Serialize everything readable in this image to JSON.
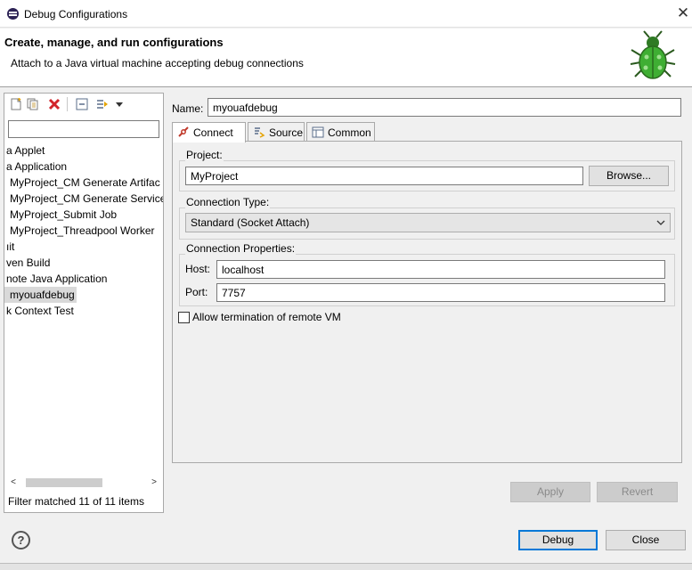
{
  "window": {
    "title": "Debug Configurations"
  },
  "header": {
    "title": "Create, manage, and run configurations",
    "description": "Attach to a Java virtual machine accepting debug connections"
  },
  "left": {
    "toolbar": [
      "new-launch-config-icon",
      "duplicate-icon",
      "delete-icon",
      "collapse-all-icon",
      "filter-icon",
      "view-menu-icon"
    ],
    "filter_value": "",
    "tree": [
      "a Applet",
      "a Application",
      "MyProject_CM Generate Artifac",
      "MyProject_CM Generate Service",
      "MyProject_Submit Job",
      "MyProject_Threadpool Worker",
      "ıit",
      "ven Build",
      "note Java Application",
      "myouafdebug",
      "k Context Test"
    ],
    "selected_index": 9,
    "filter_status": "Filter matched 11 of 11 items"
  },
  "config": {
    "name_label": "Name:",
    "name_value": "myouafdebug",
    "tabs": [
      {
        "label": "Connect",
        "icon": "connect-icon",
        "active": true
      },
      {
        "label": "Source",
        "icon": "source-icon",
        "active": false
      },
      {
        "label": "Common",
        "icon": "common-icon",
        "active": false
      }
    ],
    "project_label": "Project:",
    "project_value": "MyProject",
    "browse_label": "Browse...",
    "connection_type_label": "Connection Type:",
    "connection_type_value": "Standard (Socket Attach)",
    "connection_props_label": "Connection Properties:",
    "host_label": "Host:",
    "host_value": "localhost",
    "port_label": "Port:",
    "port_value": "7757",
    "allow_termination_label": "Allow termination of remote VM",
    "allow_termination_checked": false,
    "apply_label": "Apply",
    "revert_label": "Revert"
  },
  "footer": {
    "help_label": "?",
    "debug_label": "Debug",
    "close_label": "Close"
  },
  "colors": {
    "selection": "#d9d9d9",
    "primary_border": "#0078d7",
    "bug_green": "#3fae33"
  }
}
